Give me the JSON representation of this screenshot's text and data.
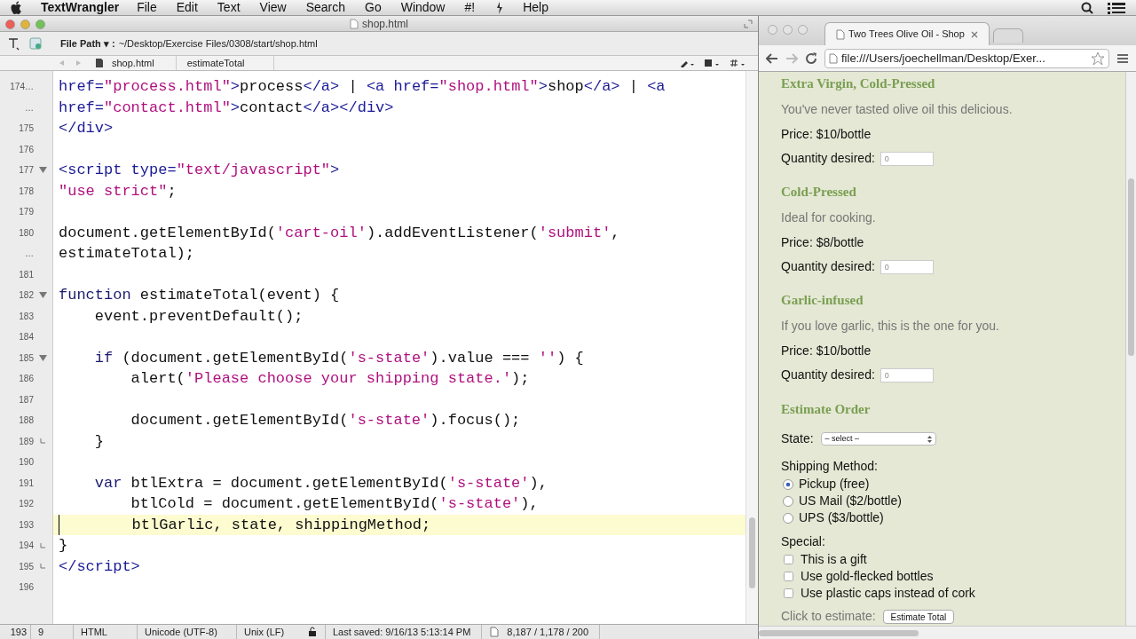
{
  "menu_bar": {
    "app": "TextWrangler",
    "items": [
      "File",
      "Edit",
      "Text",
      "View",
      "Search",
      "Go",
      "Window",
      "#!"
    ],
    "help": "Help"
  },
  "editor": {
    "title": "shop.html",
    "file_path_label": "File Path ▾ :",
    "file_path": "~/Desktop/Exercise Files/0308/start/shop.html",
    "nav": {
      "file": "shop.html",
      "function": "estimateTotal"
    },
    "lines": [
      {
        "number": "174…",
        "fold_start": false,
        "fold_end": false,
        "current": false,
        "segments": [
          {
            "t": "href=",
            "kind": "tag"
          },
          {
            "t": "\"process.html\"",
            "kind": "string"
          },
          {
            "t": ">",
            "kind": "tag"
          },
          {
            "t": "process",
            "kind": "plain"
          },
          {
            "t": "</a>",
            "kind": "tag"
          },
          {
            "t": " | ",
            "kind": "plain"
          },
          {
            "t": "<a href=",
            "kind": "tag"
          },
          {
            "t": "\"shop.html\"",
            "kind": "string"
          },
          {
            "t": ">",
            "kind": "tag"
          },
          {
            "t": "shop",
            "kind": "plain"
          },
          {
            "t": "</a>",
            "kind": "tag"
          },
          {
            "t": " | ",
            "kind": "plain"
          },
          {
            "t": "<a",
            "kind": "tag"
          }
        ]
      },
      {
        "number": "…",
        "fold_start": false,
        "fold_end": false,
        "current": false,
        "segments": [
          {
            "t": "href=",
            "kind": "tag"
          },
          {
            "t": "\"contact.html\"",
            "kind": "string"
          },
          {
            "t": ">",
            "kind": "tag"
          },
          {
            "t": "contact",
            "kind": "plain"
          },
          {
            "t": "</a></div>",
            "kind": "tag"
          }
        ]
      },
      {
        "number": "175",
        "fold_start": false,
        "fold_end": false,
        "current": false,
        "segments": [
          {
            "t": "</div>",
            "kind": "tag"
          }
        ]
      },
      {
        "number": "176",
        "fold_start": false,
        "fold_end": false,
        "current": false
      },
      {
        "number": "177",
        "fold_start": true,
        "fold_end": false,
        "current": false,
        "segments": [
          {
            "t": "<script type=",
            "kind": "tag"
          },
          {
            "t": "\"text/javascript\"",
            "kind": "string"
          },
          {
            "t": ">",
            "kind": "tag"
          }
        ]
      },
      {
        "number": "178",
        "fold_start": false,
        "fold_end": false,
        "current": false,
        "segments": [
          {
            "t": "\"use strict\"",
            "kind": "string"
          },
          {
            "t": ";",
            "kind": "plain"
          }
        ]
      },
      {
        "number": "179",
        "fold_start": false,
        "fold_end": false,
        "current": false
      },
      {
        "number": "180",
        "fold_start": false,
        "fold_end": false,
        "current": false,
        "segments": [
          {
            "t": "document.getElementById(",
            "kind": "plain"
          },
          {
            "t": "'cart-oil'",
            "kind": "string"
          },
          {
            "t": ").addEventListener(",
            "kind": "plain"
          },
          {
            "t": "'submit'",
            "kind": "string"
          },
          {
            "t": ",",
            "kind": "plain"
          }
        ]
      },
      {
        "number": "…",
        "fold_start": false,
        "fold_end": false,
        "current": false,
        "segments": [
          {
            "t": "estimateTotal);",
            "kind": "plain"
          }
        ]
      },
      {
        "number": "181",
        "fold_start": false,
        "fold_end": false,
        "current": false
      },
      {
        "number": "182",
        "fold_start": true,
        "fold_end": false,
        "current": false,
        "segments": [
          {
            "t": "function",
            "kind": "keyword"
          },
          {
            "t": " estimateTotal(event) {",
            "kind": "plain"
          }
        ]
      },
      {
        "number": "183",
        "fold_start": false,
        "fold_end": false,
        "current": false,
        "segments": [
          {
            "t": "    event.preventDefault();",
            "kind": "plain"
          }
        ]
      },
      {
        "number": "184",
        "fold_start": false,
        "fold_end": false,
        "current": false
      },
      {
        "number": "185",
        "fold_start": true,
        "fold_end": false,
        "current": false,
        "segments": [
          {
            "t": "    if",
            "kind": "keyword"
          },
          {
            "t": " (document.getElementById(",
            "kind": "plain"
          },
          {
            "t": "'s-state'",
            "kind": "string"
          },
          {
            "t": ").value === ",
            "kind": "plain"
          },
          {
            "t": "''",
            "kind": "string"
          },
          {
            "t": ") {",
            "kind": "plain"
          }
        ]
      },
      {
        "number": "186",
        "fold_start": false,
        "fold_end": false,
        "current": false,
        "segments": [
          {
            "t": "        alert(",
            "kind": "plain"
          },
          {
            "t": "'Please choose your shipping state.'",
            "kind": "string"
          },
          {
            "t": ");",
            "kind": "plain"
          }
        ]
      },
      {
        "number": "187",
        "fold_start": false,
        "fold_end": false,
        "current": false
      },
      {
        "number": "188",
        "fold_start": false,
        "fold_end": false,
        "current": false,
        "segments": [
          {
            "t": "        document.getElementById(",
            "kind": "plain"
          },
          {
            "t": "'s-state'",
            "kind": "string"
          },
          {
            "t": ").focus();",
            "kind": "plain"
          }
        ]
      },
      {
        "number": "189",
        "fold_start": false,
        "fold_end": true,
        "current": false,
        "segments": [
          {
            "t": "    }",
            "kind": "plain"
          }
        ]
      },
      {
        "number": "190",
        "fold_start": false,
        "fold_end": false,
        "current": false
      },
      {
        "number": "191",
        "fold_start": false,
        "fold_end": false,
        "current": false,
        "segments": [
          {
            "t": "    var",
            "kind": "keyword"
          },
          {
            "t": " btlExtra = document.getElementById(",
            "kind": "plain"
          },
          {
            "t": "'s-state'",
            "kind": "string"
          },
          {
            "t": "),",
            "kind": "plain"
          }
        ]
      },
      {
        "number": "192",
        "fold_start": false,
        "fold_end": false,
        "current": false,
        "segments": [
          {
            "t": "        btlCold = document.getElementById(",
            "kind": "plain"
          },
          {
            "t": "'s-state'",
            "kind": "string"
          },
          {
            "t": "),",
            "kind": "plain"
          }
        ]
      },
      {
        "number": "193",
        "fold_start": false,
        "fold_end": false,
        "current": true,
        "segments": [
          {
            "t": "        btlGarlic, state, shippingMethod;",
            "kind": "plain"
          }
        ]
      },
      {
        "number": "194",
        "fold_start": false,
        "fold_end": true,
        "current": false,
        "segments": [
          {
            "t": "}",
            "kind": "plain"
          }
        ]
      },
      {
        "number": "195",
        "fold_start": false,
        "fold_end": true,
        "current": false,
        "segments": [
          {
            "t": "</script>",
            "kind": "tag"
          }
        ]
      },
      {
        "number": "196",
        "fold_start": false,
        "fold_end": false,
        "current": false
      }
    ],
    "status_bar": {
      "line": "193",
      "column": "9",
      "language": "HTML",
      "encoding": "Unicode (UTF-8)",
      "line_endings": "Unix (LF)",
      "last_saved": "Last saved: 9/16/13 5:13:14 PM",
      "counts": "8,187 / 1,178 / 200"
    }
  },
  "browser": {
    "tab": "Two Trees Olive Oil - Shop",
    "url": "file:///Users/joechellman/Desktop/Exer...",
    "products": [
      {
        "name": "Extra Virgin, Cold-Pressed",
        "description": "You've never tasted olive oil this delicious.",
        "price": "Price: $10/bottle",
        "quantity_label": "Quantity desired:",
        "placeholder": "0"
      },
      {
        "name": "Cold-Pressed",
        "description": "Ideal for cooking.",
        "price": "Price: $8/bottle",
        "quantity_label": "Quantity desired:",
        "placeholder": "0"
      },
      {
        "name": "Garlic-infused",
        "description": "If you love garlic, this is the one for you.",
        "price": "Price: $10/bottle",
        "quantity_label": "Quantity desired:",
        "placeholder": "0"
      }
    ],
    "estimate": {
      "heading": "Estimate Order",
      "state_label": "State:",
      "state_select": "– select –",
      "shipping_label": "Shipping Method:",
      "shipping_options": [
        {
          "label": "Pickup (free)",
          "selected": true
        },
        {
          "label": "US Mail ($2/bottle)",
          "selected": false
        },
        {
          "label": "UPS ($3/bottle)",
          "selected": false
        }
      ],
      "special_label": "Special:",
      "special_options": [
        {
          "label": "This is a gift",
          "checked": false
        },
        {
          "label": "Use gold-flecked bottles",
          "checked": false
        },
        {
          "label": "Use plastic caps instead of cork",
          "checked": false
        }
      ],
      "click_label": "Click to estimate:",
      "button": "Estimate Total"
    }
  }
}
